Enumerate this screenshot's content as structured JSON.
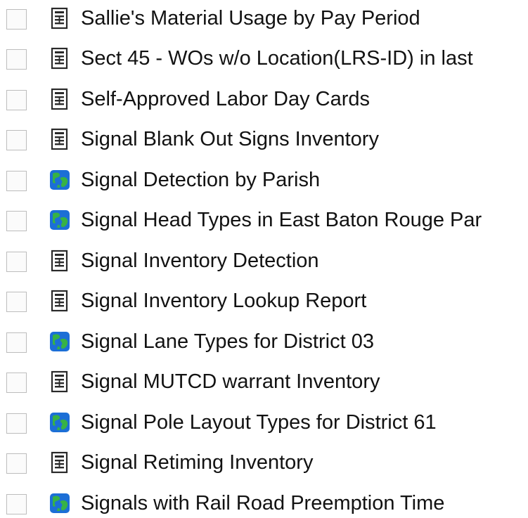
{
  "reports": [
    {
      "name": "Sallie's Material Usage by Pay Period",
      "icon": "report-document-icon"
    },
    {
      "name": "Sect 45 - WOs w/o Location(LRS-ID) in last",
      "icon": "report-document-icon"
    },
    {
      "name": "Self-Approved Labor Day Cards",
      "icon": "report-document-icon"
    },
    {
      "name": "Signal Blank Out Signs Inventory",
      "icon": "report-document-icon"
    },
    {
      "name": "Signal Detection by Parish",
      "icon": "map-globe-icon"
    },
    {
      "name": "Signal Head Types in East Baton Rouge Par",
      "icon": "map-globe-icon"
    },
    {
      "name": "Signal Inventory Detection",
      "icon": "report-document-icon"
    },
    {
      "name": "Signal Inventory Lookup Report",
      "icon": "report-document-icon"
    },
    {
      "name": "Signal Lane Types for District 03",
      "icon": "map-globe-icon"
    },
    {
      "name": "Signal MUTCD warrant Inventory",
      "icon": "report-document-icon"
    },
    {
      "name": "Signal Pole Layout Types for District 61",
      "icon": "map-globe-icon"
    },
    {
      "name": "Signal Retiming Inventory",
      "icon": "report-document-icon"
    },
    {
      "name": "Signals with Rail Road Preemption Time",
      "icon": "map-globe-icon"
    }
  ]
}
